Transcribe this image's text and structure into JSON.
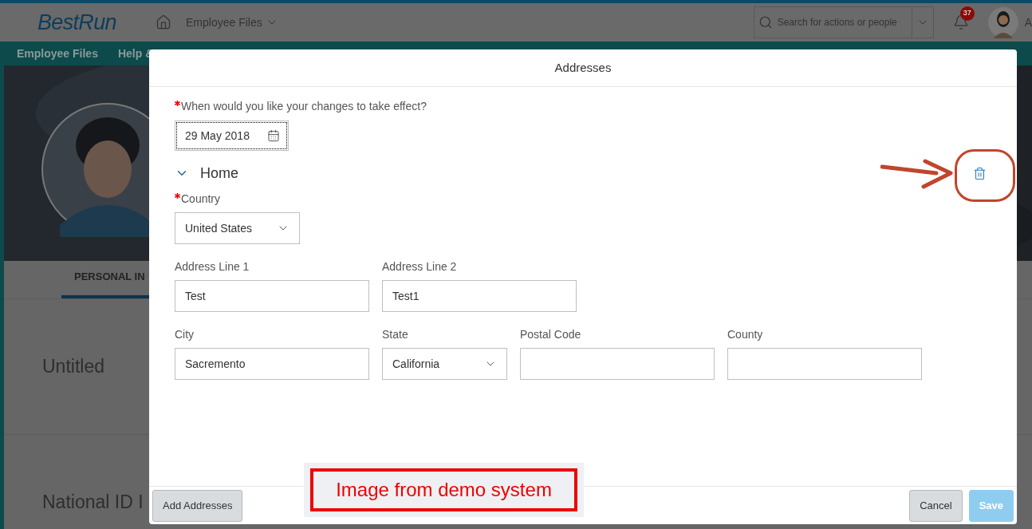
{
  "header": {
    "logo": "BestRun",
    "nav_menu": "Employee Files",
    "search": {
      "placeholder": "Search for actions or people"
    },
    "notification_count": "37",
    "user_initial": "A"
  },
  "subnav": [
    "Employee Files",
    "Help &"
  ],
  "tabs": [
    {
      "label": "PERSONAL IN",
      "selected": true
    }
  ],
  "sections": [
    "Untitled",
    "National ID I"
  ],
  "dialog": {
    "title": "Addresses",
    "effective_date": {
      "label": "When would you like your changes to take effect?",
      "required": true,
      "value": "29 May 2018"
    },
    "section": {
      "title": "Home",
      "expanded": true
    },
    "rows": [
      {
        "fields": [
          {
            "kind": "select",
            "label": "Country",
            "required": true,
            "value": "United States"
          }
        ]
      },
      {
        "fields": [
          {
            "kind": "input",
            "label": "Address Line 1",
            "required": false,
            "value": "Test"
          },
          {
            "kind": "input",
            "label": "Address Line 2",
            "required": false,
            "value": "Test1"
          }
        ]
      },
      {
        "fields": [
          {
            "kind": "input",
            "label": "City",
            "required": false,
            "value": "Sacremento"
          },
          {
            "kind": "select",
            "label": "State",
            "required": false,
            "value": "California"
          },
          {
            "kind": "input",
            "label": "Postal Code",
            "required": false
          },
          {
            "kind": "input",
            "label": "County",
            "required": false
          }
        ]
      }
    ],
    "buttons": [
      {
        "label": "Add Addresses",
        "kind": "secondary",
        "disabled": false
      },
      {
        "label": "Cancel",
        "kind": "secondary",
        "disabled": false
      },
      {
        "label": "Save",
        "kind": "primary",
        "disabled": true
      }
    ]
  },
  "annotation": {
    "label": "Image from demo system"
  }
}
